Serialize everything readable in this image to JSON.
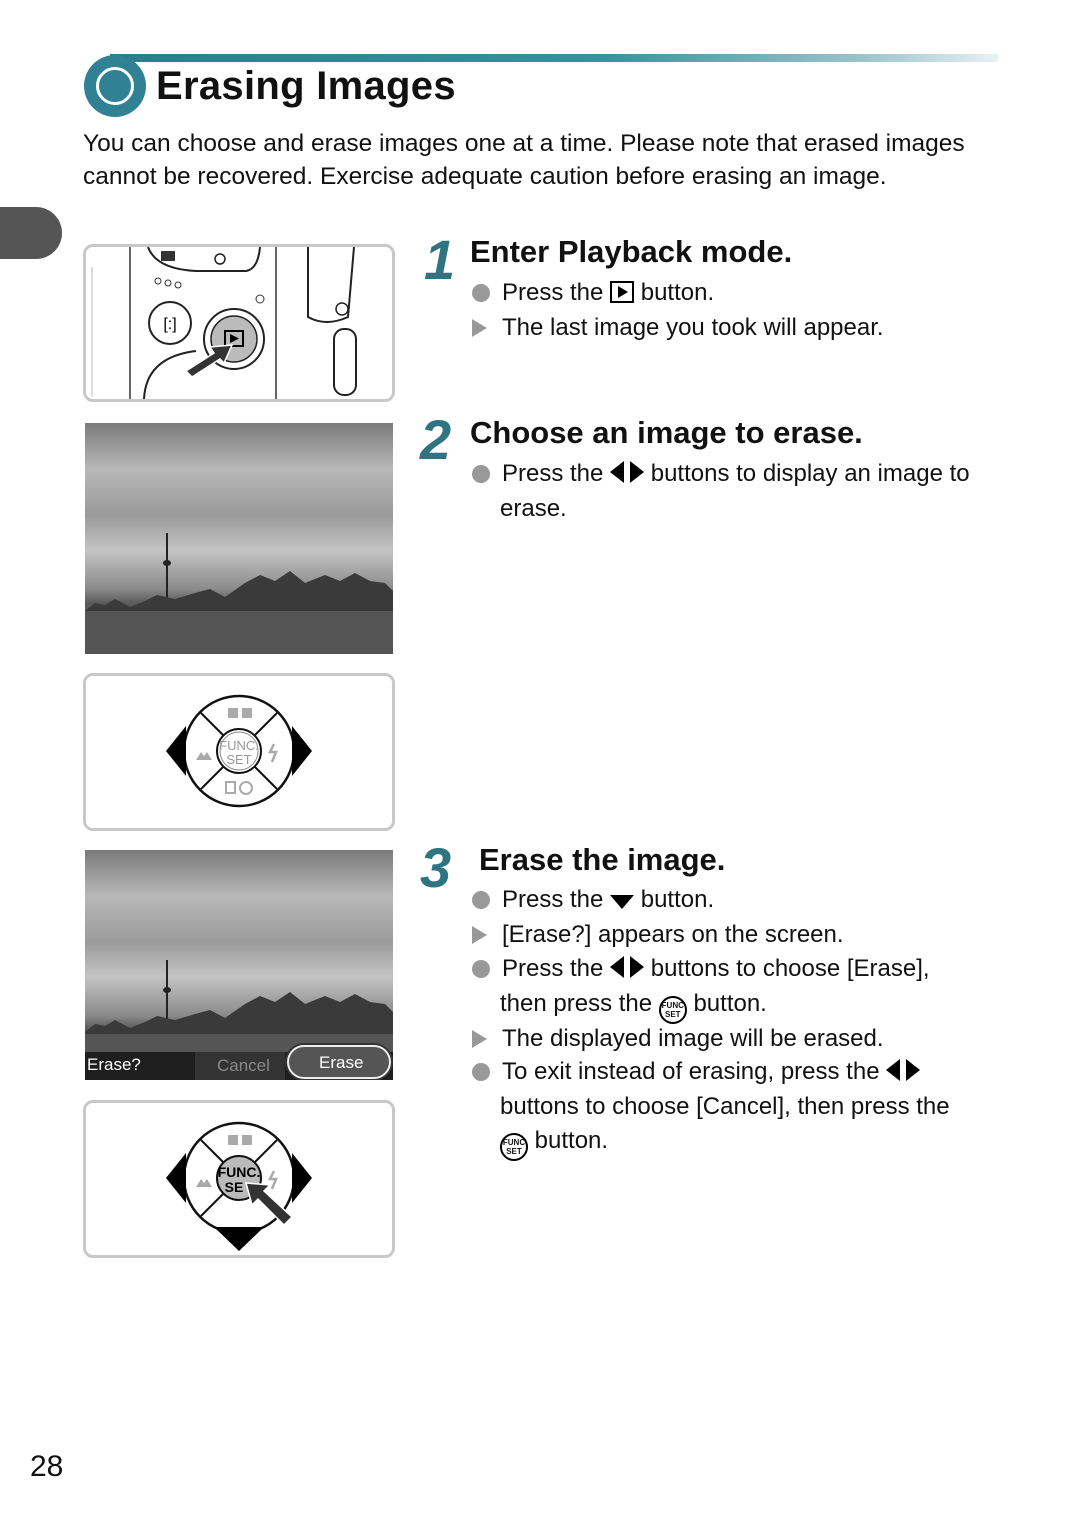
{
  "header": {
    "title": "Erasing Images",
    "accent_color": "#2f8193"
  },
  "intro": "You can choose and erase images one at a time. Please note that erased images cannot be recovered. Exercise adequate caution before erasing an image.",
  "steps": [
    {
      "number": "1",
      "title": "Enter Playback mode.",
      "items": [
        {
          "type": "bullet",
          "before": "Press the",
          "icon": "playback-icon",
          "after": "button."
        },
        {
          "type": "result",
          "text": "The last image you took will appear."
        }
      ]
    },
    {
      "number": "2",
      "title": "Choose an image to erase.",
      "items": [
        {
          "type": "bullet",
          "before": "Press the",
          "icon": "left-right-arrows-icon",
          "after": "buttons to display an image to",
          "cont": "erase."
        }
      ]
    },
    {
      "number": "3",
      "title": "Erase the image.",
      "items": [
        {
          "type": "bullet",
          "before": "Press the",
          "icon": "down-arrow-icon",
          "after": "button."
        },
        {
          "type": "result",
          "text": "[Erase?] appears on the screen."
        },
        {
          "type": "bullet",
          "before": "Press the",
          "icon": "left-right-arrows-icon",
          "after": "buttons to choose [Erase],",
          "cont_before": "then press the",
          "cont_icon": "func-set-icon",
          "cont_after": "button."
        },
        {
          "type": "result",
          "text": "The displayed image will be erased."
        },
        {
          "type": "bullet",
          "before": "To exit instead of erasing, press the",
          "icon": "left-right-arrows-icon",
          "after": "",
          "cont": "buttons to choose [Cancel], then press the",
          "cont2_icon": "func-set-icon",
          "cont2_after": "button."
        }
      ]
    }
  ],
  "illustrations": {
    "camera_labels": {
      "func": "FUNC.",
      "set": "SET"
    },
    "erase_screen": {
      "prompt": "Erase?",
      "cancel": "Cancel",
      "erase": "Erase"
    },
    "func_icon": {
      "top": "FUNC",
      "bottom": "SET"
    }
  },
  "page_number": "28"
}
